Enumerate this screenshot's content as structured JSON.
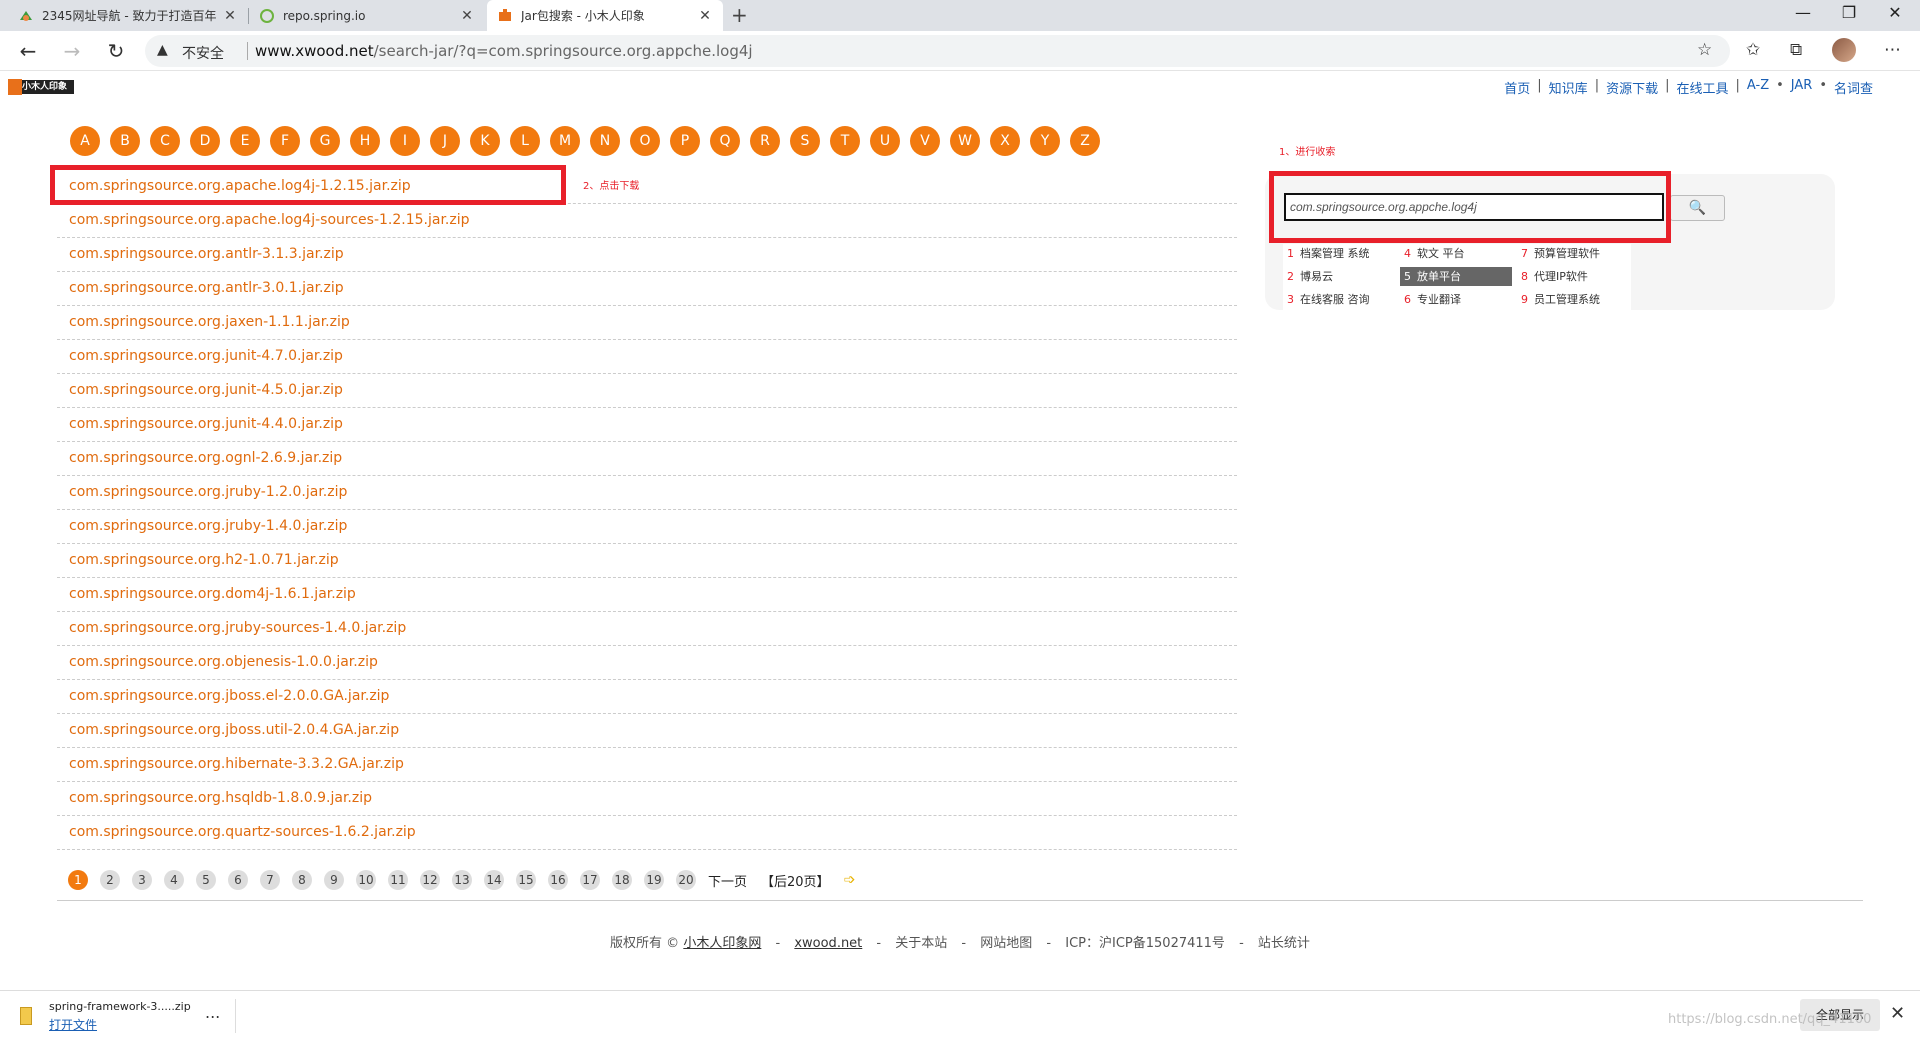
{
  "browser": {
    "tabs": [
      {
        "title": "2345网址导航 - 致力于打造百年"
      },
      {
        "title": "repo.spring.io"
      },
      {
        "title": "Jar包搜索 - 小木人印象"
      }
    ],
    "new_tab": "+",
    "security_label": "不安全",
    "url_host": "www.xwood.net",
    "url_path": "/search-jar/?q=com.springsource.org.appche.log4j",
    "window_controls": [
      "—",
      "❐",
      "✕"
    ]
  },
  "site": {
    "logo_text": "小木人印象",
    "topnav": [
      "首页",
      "知识库",
      "资源下载",
      "在线工具",
      "A-Z",
      "JAR",
      "名词查"
    ],
    "topnav_seps": [
      "|",
      "|",
      "|",
      "|",
      "•",
      "•"
    ],
    "letters": [
      "A",
      "B",
      "C",
      "D",
      "E",
      "F",
      "G",
      "H",
      "I",
      "J",
      "K",
      "L",
      "M",
      "N",
      "O",
      "P",
      "Q",
      "R",
      "S",
      "T",
      "U",
      "V",
      "W",
      "X",
      "Y",
      "Z"
    ],
    "results": [
      "com.springsource.org.apache.log4j-1.2.15.jar.zip",
      "com.springsource.org.apache.log4j-sources-1.2.15.jar.zip",
      "com.springsource.org.antlr-3.1.3.jar.zip",
      "com.springsource.org.antlr-3.0.1.jar.zip",
      "com.springsource.org.jaxen-1.1.1.jar.zip",
      "com.springsource.org.junit-4.7.0.jar.zip",
      "com.springsource.org.junit-4.5.0.jar.zip",
      "com.springsource.org.junit-4.4.0.jar.zip",
      "com.springsource.org.ognl-2.6.9.jar.zip",
      "com.springsource.org.jruby-1.2.0.jar.zip",
      "com.springsource.org.jruby-1.4.0.jar.zip",
      "com.springsource.org.h2-1.0.71.jar.zip",
      "com.springsource.org.dom4j-1.6.1.jar.zip",
      "com.springsource.org.jruby-sources-1.4.0.jar.zip",
      "com.springsource.org.objenesis-1.0.0.jar.zip",
      "com.springsource.org.jboss.el-2.0.0.GA.jar.zip",
      "com.springsource.org.jboss.util-2.0.4.GA.jar.zip",
      "com.springsource.org.hibernate-3.3.2.GA.jar.zip",
      "com.springsource.org.hsqldb-1.8.0.9.jar.zip",
      "com.springsource.org.quartz-sources-1.6.2.jar.zip"
    ],
    "annotation_search": "1、进行收索",
    "annotation_download": "2、点击下载",
    "search_value": "com.springsource.org.appche.log4j",
    "suggestions": [
      {
        "num": "1",
        "text": "档案管理 系统"
      },
      {
        "num": "2",
        "text": "博易云"
      },
      {
        "num": "3",
        "text": "在线客服 咨询"
      },
      {
        "num": "4",
        "text": "软文 平台"
      },
      {
        "num": "5",
        "text": "放单平台"
      },
      {
        "num": "6",
        "text": "专业翻译"
      },
      {
        "num": "7",
        "text": "预算管理软件"
      },
      {
        "num": "8",
        "text": "代理IP软件"
      },
      {
        "num": "9",
        "text": "员工管理系统"
      }
    ],
    "pages": [
      "1",
      "2",
      "3",
      "4",
      "5",
      "6",
      "7",
      "8",
      "9",
      "10",
      "11",
      "12",
      "13",
      "14",
      "15",
      "16",
      "17",
      "18",
      "19",
      "20"
    ],
    "next_label": "下一页",
    "after_label": "【后20页】",
    "footer": {
      "copyright": "版权所有 ©",
      "site_name": "小木人印象网",
      "domain": "xwood.net",
      "about": "关于本站",
      "sitemap": "网站地图",
      "icp": "ICP：沪ICP备15027411号",
      "stats": "站长统计",
      "dash": "-"
    }
  },
  "download_bar": {
    "filename": "spring-framework-3.....zip",
    "open_label": "打开文件",
    "more": "...",
    "show_all": "全部显示",
    "close": "✕"
  },
  "watermark": "https://blog.csdn.net/qq_41100"
}
